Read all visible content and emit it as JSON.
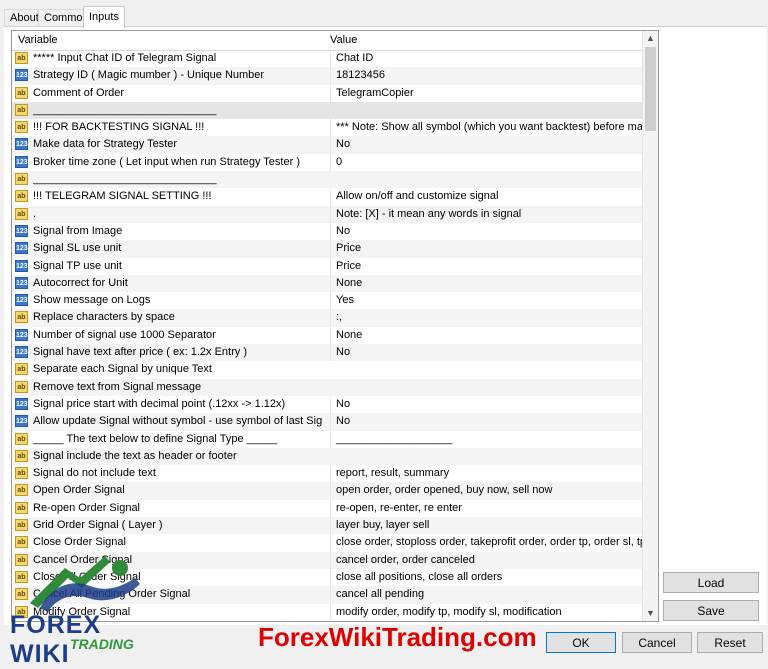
{
  "tabs": [
    "About",
    "Common",
    "Inputs"
  ],
  "header": {
    "variable": "Variable",
    "value": "Value"
  },
  "rows": [
    {
      "type": "ab",
      "var": "***** Input Chat ID of Telegram Signal",
      "val": "Chat ID"
    },
    {
      "type": "123",
      "var": "Strategy ID ( Magic mumber ) - Unique Number",
      "val": "18123456"
    },
    {
      "type": "ab",
      "var": "Comment of Order",
      "val": "TelegramCopier"
    },
    {
      "type": "ab",
      "var": "______________________________",
      "val": ""
    },
    {
      "type": "ab",
      "var": "!!! FOR BACKTESTING SIGNAL !!!",
      "val": "*** Note: Show all symbol (which you want backtest) before make data"
    },
    {
      "type": "123",
      "var": "Make data for Strategy Tester",
      "val": "No"
    },
    {
      "type": "123",
      "var": "Broker time zone ( Let input when run Strategy Tester )",
      "val": "0"
    },
    {
      "type": "ab",
      "var": "______________________________",
      "val": ""
    },
    {
      "type": "ab",
      "var": "!!! TELEGRAM SIGNAL SETTING !!!",
      "val": "Allow on/off and customize signal"
    },
    {
      "type": "ab",
      "var": ".",
      "val": "Note: [X] - it mean any words in signal"
    },
    {
      "type": "123",
      "var": "Signal from Image",
      "val": "No"
    },
    {
      "type": "123",
      "var": "Signal SL use unit",
      "val": "Price"
    },
    {
      "type": "123",
      "var": "Signal TP use unit",
      "val": "Price"
    },
    {
      "type": "123",
      "var": "Autocorrect for Unit",
      "val": "None"
    },
    {
      "type": "123",
      "var": "Show message on Logs",
      "val": "Yes"
    },
    {
      "type": "ab",
      "var": "Replace characters by space",
      "val": ":,"
    },
    {
      "type": "123",
      "var": "Number of signal use 1000 Separator",
      "val": "None"
    },
    {
      "type": "123",
      "var": "Signal have text after price ( ex: 1.2x Entry )",
      "val": "No"
    },
    {
      "type": "ab",
      "var": "Separate each Signal by unique Text",
      "val": ""
    },
    {
      "type": "ab",
      "var": "Remove text from Signal message",
      "val": ""
    },
    {
      "type": "123",
      "var": "Signal price start with decimal point (.12xx -> 1.12x)",
      "val": "No"
    },
    {
      "type": "123",
      "var": "Allow update Signal without symbol - use symbol of last Signal",
      "val": "No"
    },
    {
      "type": "ab",
      "var": "_____ The text below to define Signal Type _____",
      "val": "___________________"
    },
    {
      "type": "ab",
      "var": "Signal include the text as header or footer",
      "val": ""
    },
    {
      "type": "ab",
      "var": "Signal do not include text",
      "val": "report, result, summary"
    },
    {
      "type": "ab",
      "var": "Open Order Signal",
      "val": "open order, order opened, buy now, sell now"
    },
    {
      "type": "ab",
      "var": "Re-open Order Signal",
      "val": "re-open, re-enter, re enter"
    },
    {
      "type": "ab",
      "var": "Grid Order Signal ( Layer )",
      "val": "layer buy, layer sell"
    },
    {
      "type": "ab",
      "var": "Close Order Signal",
      "val": "close order, stoploss order, takeprofit order, order tp, order sl, tp[X] hit"
    },
    {
      "type": "ab",
      "var": "Cancel Order Signal",
      "val": "cancel order, order canceled"
    },
    {
      "type": "ab",
      "var": "Close All Order Signal",
      "val": "close all positions, close all orders"
    },
    {
      "type": "ab",
      "var": "Cancel All Pending Order Signal",
      "val": "cancel all pending"
    },
    {
      "type": "ab",
      "var": "Modify Order Signal",
      "val": "modify order, modify tp, modify sl, modification"
    }
  ],
  "buttons": {
    "load": "Load",
    "save": "Save",
    "ok": "OK",
    "cancel": "Cancel",
    "reset": "Reset"
  },
  "watermark": "ForexWikiTrading.com",
  "logo": {
    "brand": "FOREX WIKI",
    "sub": "TRADING"
  },
  "colors": {
    "watermark": "#e00000",
    "selection": "#e5e5e5",
    "ok_border": "#0078d7"
  }
}
